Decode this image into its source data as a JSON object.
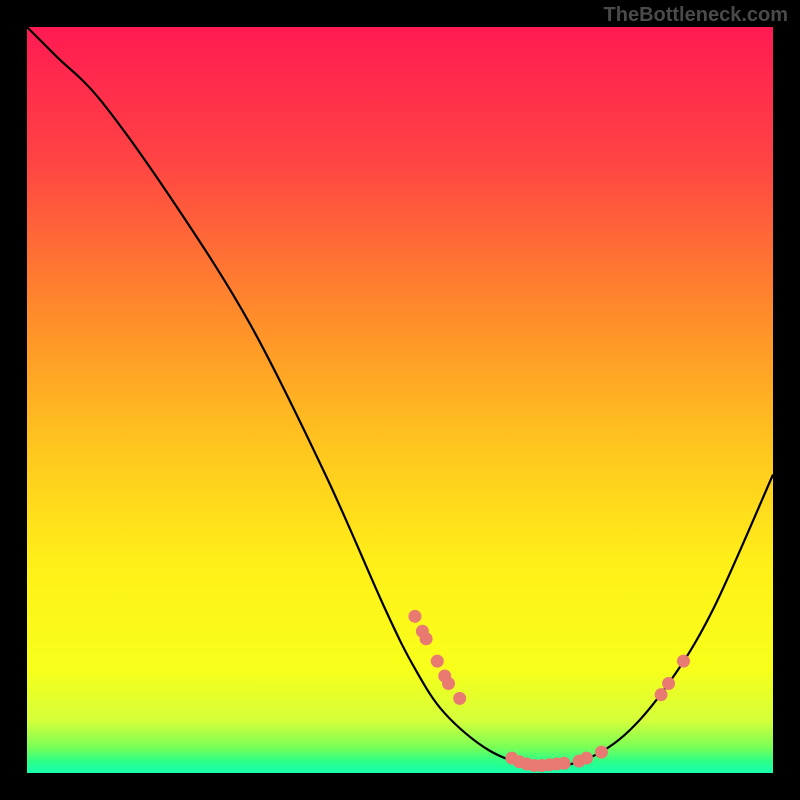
{
  "watermark": "TheBottleneck.com",
  "chart_data": {
    "type": "line",
    "title": "",
    "xlabel": "",
    "ylabel": "",
    "xlim": [
      0,
      100
    ],
    "ylim": [
      0,
      100
    ],
    "curve": [
      {
        "x": 0,
        "y": 100
      },
      {
        "x": 4,
        "y": 96
      },
      {
        "x": 10,
        "y": 90
      },
      {
        "x": 20,
        "y": 76
      },
      {
        "x": 30,
        "y": 60
      },
      {
        "x": 40,
        "y": 40
      },
      {
        "x": 48,
        "y": 22
      },
      {
        "x": 52,
        "y": 14
      },
      {
        "x": 56,
        "y": 8
      },
      {
        "x": 62,
        "y": 3
      },
      {
        "x": 68,
        "y": 1
      },
      {
        "x": 74,
        "y": 1.5
      },
      {
        "x": 80,
        "y": 5
      },
      {
        "x": 86,
        "y": 12
      },
      {
        "x": 92,
        "y": 22
      },
      {
        "x": 100,
        "y": 40
      }
    ],
    "highlighted_points": [
      {
        "x": 52,
        "y": 21
      },
      {
        "x": 53,
        "y": 19
      },
      {
        "x": 53.5,
        "y": 18
      },
      {
        "x": 55,
        "y": 15
      },
      {
        "x": 56,
        "y": 13
      },
      {
        "x": 56.5,
        "y": 12
      },
      {
        "x": 58,
        "y": 10
      },
      {
        "x": 65,
        "y": 2
      },
      {
        "x": 66,
        "y": 1.5
      },
      {
        "x": 67,
        "y": 1.2
      },
      {
        "x": 68,
        "y": 1
      },
      {
        "x": 69,
        "y": 1
      },
      {
        "x": 70,
        "y": 1.1
      },
      {
        "x": 71,
        "y": 1.2
      },
      {
        "x": 72,
        "y": 1.3
      },
      {
        "x": 74,
        "y": 1.6
      },
      {
        "x": 75,
        "y": 2
      },
      {
        "x": 77,
        "y": 2.8
      },
      {
        "x": 85,
        "y": 10.5
      },
      {
        "x": 86,
        "y": 12
      },
      {
        "x": 88,
        "y": 15
      }
    ],
    "gradient_stops": [
      {
        "offset": 0,
        "color": "#ff1a52"
      },
      {
        "offset": 18,
        "color": "#ff4444"
      },
      {
        "offset": 38,
        "color": "#ff8a2b"
      },
      {
        "offset": 55,
        "color": "#ffc21f"
      },
      {
        "offset": 72,
        "color": "#fff019"
      },
      {
        "offset": 86,
        "color": "#f8ff1a"
      },
      {
        "offset": 93,
        "color": "#d4ff3a"
      },
      {
        "offset": 96.5,
        "color": "#7bff55"
      },
      {
        "offset": 98.5,
        "color": "#2bff88"
      },
      {
        "offset": 100,
        "color": "#18ffb0"
      }
    ],
    "point_color": "#e87a72",
    "curve_color": "#000000"
  }
}
